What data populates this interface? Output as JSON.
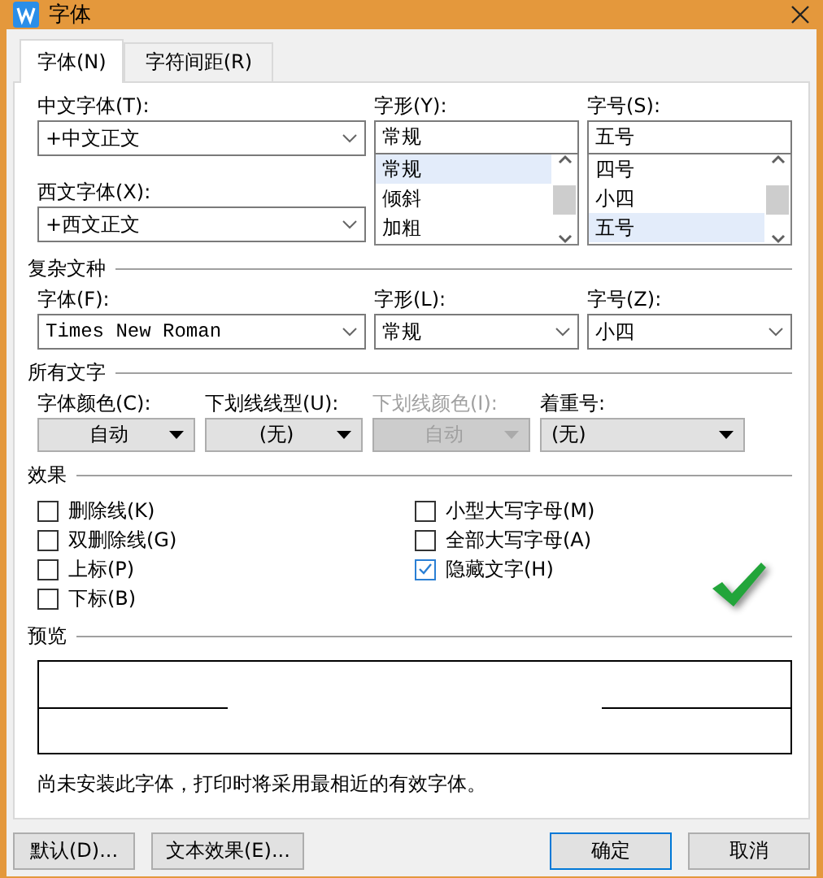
{
  "window": {
    "title": "字体"
  },
  "tabs": [
    {
      "label": "字体(N)",
      "selected": true
    },
    {
      "label": "字符间距(R)",
      "selected": false
    }
  ],
  "chinese_font": {
    "label": "中文字体(T):",
    "value": "+中文正文"
  },
  "western_font": {
    "label": "西文字体(X):",
    "value": "+西文正文"
  },
  "style": {
    "label": "字形(Y):",
    "value": "常规",
    "options": [
      {
        "label": "常规",
        "selected": true
      },
      {
        "label": "倾斜",
        "selected": false
      },
      {
        "label": "加粗",
        "selected": false
      }
    ]
  },
  "size": {
    "label": "字号(S):",
    "value": "五号",
    "options": [
      {
        "label": "四号",
        "selected": false
      },
      {
        "label": "小四",
        "selected": false
      },
      {
        "label": "五号",
        "selected": true
      }
    ]
  },
  "complex_script": {
    "title": "复杂文种",
    "fields": [
      {
        "label": "字体(F):",
        "value": "Times New Roman"
      },
      {
        "label": "字形(L):",
        "value": "常规"
      },
      {
        "label": "字号(Z):",
        "value": "小四"
      }
    ]
  },
  "all_text": {
    "title": "所有文字",
    "fields": [
      {
        "label": "字体颜色(C):",
        "value": "自动",
        "disabled": false
      },
      {
        "label": "下划线线型(U):",
        "value": "(无)",
        "disabled": false
      },
      {
        "label": "下划线颜色(I):",
        "value": "自动",
        "disabled": true
      },
      {
        "label": "着重号:",
        "value": "(无)",
        "disabled": false
      }
    ]
  },
  "effects": {
    "title": "效果",
    "columns": [
      [
        {
          "label": "删除线(K)",
          "checked": false
        },
        {
          "label": "双删除线(G)",
          "checked": false
        },
        {
          "label": "上标(P)",
          "checked": false
        },
        {
          "label": "下标(B)",
          "checked": false
        }
      ],
      [
        {
          "label": "小型大写字母(M)",
          "checked": false
        },
        {
          "label": "全部大写字母(A)",
          "checked": false
        },
        {
          "label": "隐藏文字(H)",
          "checked": true
        }
      ]
    ]
  },
  "preview": {
    "title": "预览"
  },
  "note": "尚未安装此字体，打印时将采用最相近的有效字体。",
  "left_buttons": [
    {
      "label": "默认(D)...",
      "focused": false
    },
    {
      "label": "文本效果(E)...",
      "focused": false
    }
  ],
  "right_buttons": [
    {
      "label": "确定",
      "focused": true
    },
    {
      "label": "取消",
      "focused": false
    }
  ]
}
